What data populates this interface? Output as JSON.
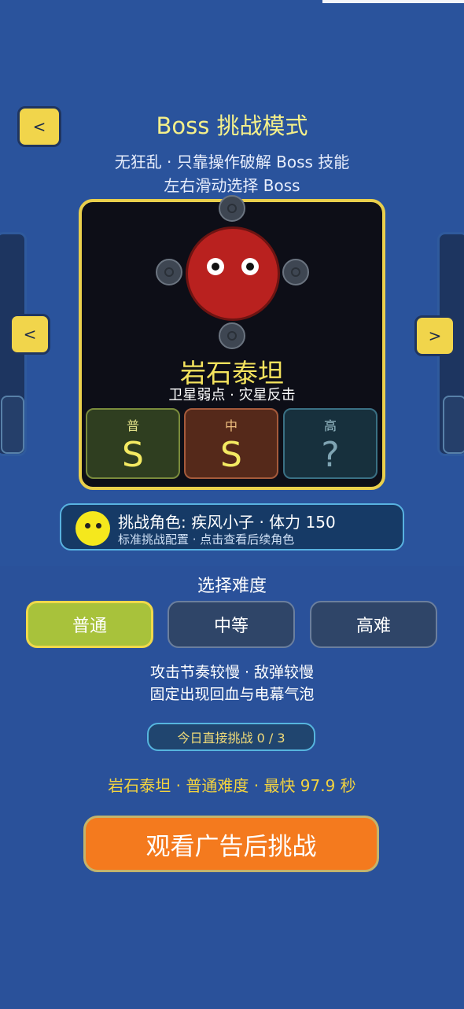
{
  "header": {
    "back_label": "<",
    "title": "Boss 挑战模式",
    "subtitle_line1": "无狂乱 · 只靠操作破解 Boss 技能",
    "subtitle_line2": "左右滑动选择 Boss"
  },
  "carousel": {
    "prev_label": "<",
    "next_label": ">"
  },
  "boss": {
    "name": "岩石泰坦",
    "traits": "卫星弱点 · 灾星反击",
    "grades": [
      {
        "label": "普",
        "value": "S"
      },
      {
        "label": "中",
        "value": "S"
      },
      {
        "label": "高",
        "value": "?"
      }
    ]
  },
  "character": {
    "main": "挑战角色: 疾风小子 · 体力 150",
    "sub": "标准挑战配置 · 点击查看后续角色"
  },
  "difficulty": {
    "title": "选择难度",
    "options": [
      "普通",
      "中等",
      "高难"
    ],
    "selected": "普通",
    "desc_line1": "攻击节奏较慢 · 敌弹较慢",
    "desc_line2": "固定出现回血与电幕气泡"
  },
  "daily": {
    "label": "今日直接挑战 0 / 3"
  },
  "record": "岩石泰坦 · 普通难度 · 最快 97.9 秒",
  "cta_label": "观看广告后挑战",
  "colors": {
    "background": "#2a519a",
    "accent_yellow": "#f1d54b",
    "selected_green": "#a8c23b",
    "cta_orange": "#f47a1e",
    "boss_red": "#b9211f"
  }
}
